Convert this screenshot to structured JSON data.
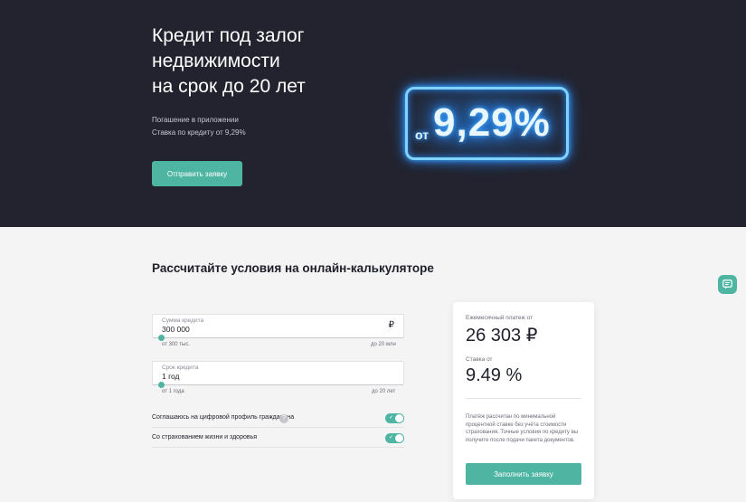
{
  "hero": {
    "title_lines": [
      "Кредит под залог",
      "недвижимости",
      "на срок до 20 лет"
    ],
    "subtitle_lines": [
      "Погашение в приложении",
      "Ставка по кредиту от 9,29%"
    ],
    "cta_label": "Отправить заявку",
    "promo_from": "от",
    "promo_rate": "9,29%"
  },
  "calculator": {
    "title": "Рассчитайте условия на онлайн-калькуляторе",
    "amount": {
      "label": "Сумма кредита",
      "value": "300 000",
      "currency": "₽",
      "min_label": "от 300 тыс.",
      "max_label": "до 20 млн",
      "slider_fraction": 0
    },
    "term": {
      "label": "Срок кредита",
      "value": "1 год",
      "min_label": "от 1 года",
      "max_label": "до 20 лет",
      "slider_fraction": 0
    },
    "toggles": [
      {
        "label": "Соглашаюсь на цифровой профиль гражданина",
        "help": "?",
        "on": true
      },
      {
        "label": "Со страхованием жизни и здоровья",
        "on": true
      }
    ]
  },
  "result": {
    "payment_label": "Ежемесячный платеж от",
    "payment_value": "26 303 ₽",
    "rate_label": "Ставка от",
    "rate_value": "9.49 %",
    "note": "Платёж рассчитан по минимальной процентной ставке без учёта стоимости страхования. Точные условия по кредиту вы получите после подачи пакета документов.",
    "cta_label": "Заполнить заявку"
  },
  "icons": {
    "chat": "chat-icon",
    "ruble": "ruble-icon",
    "help": "help-icon",
    "check": "check-icon"
  },
  "colors": {
    "hero_bg": "#22232f",
    "accent": "#4fb5a3",
    "neon": "#7fd4ff"
  }
}
